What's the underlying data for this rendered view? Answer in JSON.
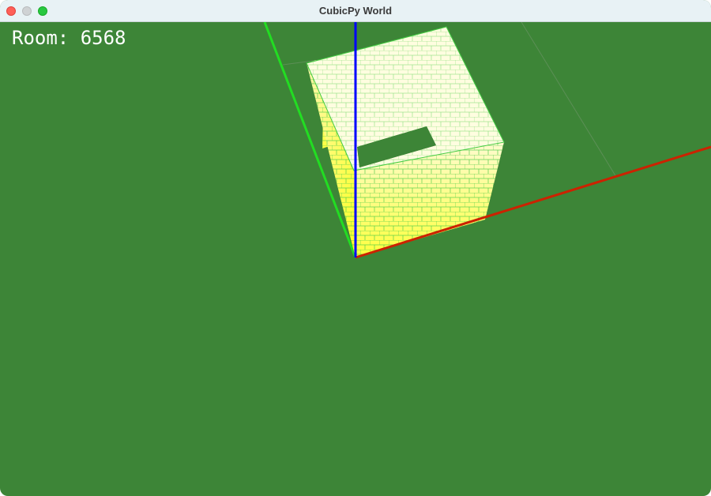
{
  "window": {
    "title": "CubicPy World"
  },
  "hud": {
    "room_text": "Room: 6568"
  },
  "scene": {
    "background_color": "#3d8537",
    "axes": {
      "x_axis_color": "#cc2200",
      "y_axis_color": "#22dd22",
      "z_axis_color": "#0000ff"
    },
    "structure": {
      "name": "hollow-brick-cube",
      "top_color": "#fffde0",
      "side_color": "#ffff55",
      "edge_color": "#44cc44"
    }
  }
}
